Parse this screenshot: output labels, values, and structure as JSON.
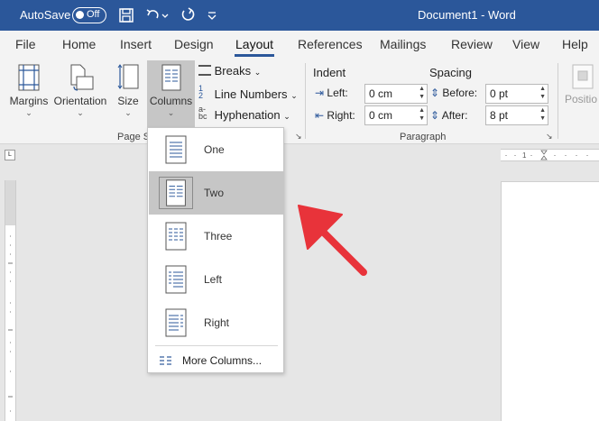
{
  "titlebar": {
    "autosave_label": "AutoSave",
    "autosave_state": "Off",
    "document_title": "Document1  -  Word",
    "accent_color": "#2b579a"
  },
  "tabs": [
    "File",
    "Home",
    "Insert",
    "Design",
    "Layout",
    "References",
    "Mailings",
    "Review",
    "View",
    "Help"
  ],
  "active_tab": "Layout",
  "ribbon": {
    "page_setup": {
      "margins": "Margins",
      "orientation": "Orientation",
      "size": "Size",
      "columns": "Columns",
      "breaks": "Breaks",
      "line_numbers": "Line Numbers",
      "hyphenation": "Hyphenation",
      "group_label": "Page S"
    },
    "paragraph": {
      "indent_label": "Indent",
      "spacing_label": "Spacing",
      "left_label": "Left:",
      "left_value": "0 cm",
      "right_label": "Right:",
      "right_value": "0 cm",
      "before_label": "Before:",
      "before_value": "0 pt",
      "after_label": "After:",
      "after_value": "8 pt",
      "group_label": "Paragraph"
    },
    "arrange": {
      "position": "Positio"
    }
  },
  "columns_menu": {
    "items": [
      {
        "label": "One",
        "icon": "one-column-icon",
        "selected": false
      },
      {
        "label": "Two",
        "icon": "two-columns-icon",
        "selected": true
      },
      {
        "label": "Three",
        "icon": "three-columns-icon",
        "selected": false
      },
      {
        "label": "Left",
        "icon": "left-columns-icon",
        "selected": false
      },
      {
        "label": "Right",
        "icon": "right-columns-icon",
        "selected": false
      }
    ],
    "more_label": "More Columns..."
  },
  "colors": {
    "arrow": "#e8333a",
    "selected_item_bg": "#c6c6c6"
  }
}
